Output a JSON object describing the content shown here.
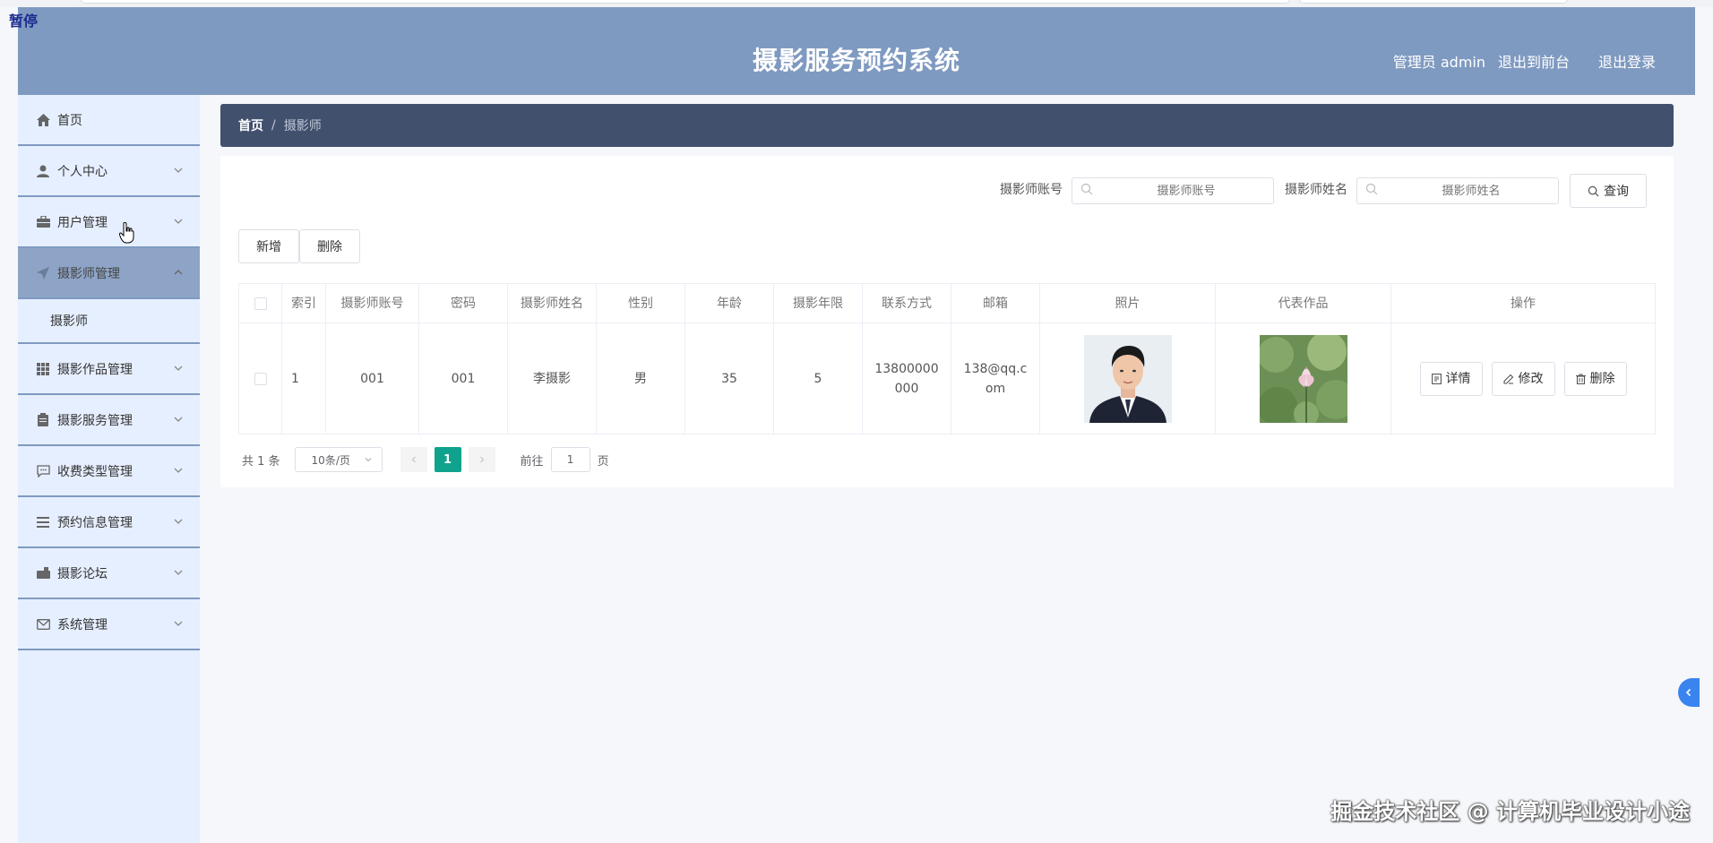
{
  "overlay": {
    "pause_label": "暂停"
  },
  "header": {
    "title": "摄影服务预约系统",
    "user_label": "管理员 admin",
    "back_to_front": "退出到前台",
    "logout": "退出登录"
  },
  "sidebar": {
    "items": [
      {
        "label": "首页",
        "icon": "home-icon"
      },
      {
        "label": "个人中心",
        "icon": "user-icon"
      },
      {
        "label": "用户管理",
        "icon": "briefcase-icon"
      },
      {
        "label": "摄影师管理",
        "icon": "send-icon",
        "active": true,
        "sub": [
          "摄影师"
        ]
      },
      {
        "label": "摄影作品管理",
        "icon": "grid-icon"
      },
      {
        "label": "摄影服务管理",
        "icon": "clipboard-icon"
      },
      {
        "label": "收费类型管理",
        "icon": "chat-icon"
      },
      {
        "label": "预约信息管理",
        "icon": "list-icon"
      },
      {
        "label": "摄影论坛",
        "icon": "forum-icon"
      },
      {
        "label": "系统管理",
        "icon": "mail-icon"
      }
    ]
  },
  "breadcrumb": {
    "home": "首页",
    "separator": "/",
    "current": "摄影师"
  },
  "search": {
    "account_label": "摄影师账号",
    "account_placeholder": "摄影师账号",
    "name_label": "摄影师姓名",
    "name_placeholder": "摄影师姓名",
    "query_button": "查询"
  },
  "toolbar": {
    "add": "新增",
    "delete": "删除"
  },
  "table": {
    "headers": [
      "索引",
      "摄影师账号",
      "密码",
      "摄影师姓名",
      "性别",
      "年龄",
      "摄影年限",
      "联系方式",
      "邮箱",
      "照片",
      "代表作品",
      "操作"
    ],
    "rows": [
      {
        "index": "1",
        "account": "001",
        "password": "001",
        "name": "李摄影",
        "gender": "男",
        "age": "35",
        "years": "5",
        "phone": "13800000000",
        "email": "138@qq.com",
        "photo": "portrait",
        "work": "lotus"
      }
    ],
    "actions": {
      "detail": "详情",
      "edit": "修改",
      "delete": "删除"
    }
  },
  "pagination": {
    "total": "共 1 条",
    "page_size": "10条/页",
    "current_page": "1",
    "goto_label": "前往",
    "goto_value": "1",
    "page_suffix": "页"
  },
  "watermark": "掘金技术社区 @ 计算机毕业设计小途",
  "colors": {
    "header_bg": "#7f9ac1",
    "sidebar_bg": "#e6efff",
    "breadcrumb_bg": "#41506d",
    "active_page": "#0fa38d",
    "toggle": "#3a84f0"
  }
}
